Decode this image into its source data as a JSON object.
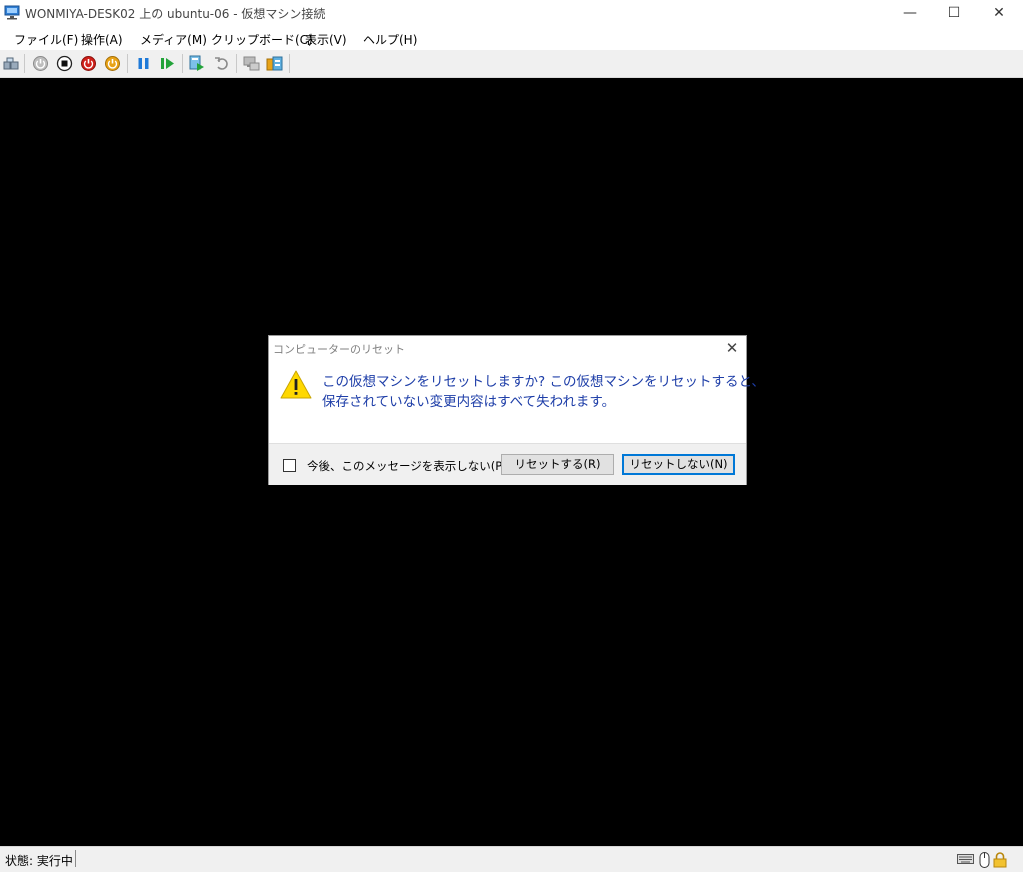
{
  "window": {
    "title": "WONMIYA-DESK02 上の ubuntu-06  - 仮想マシン接続",
    "minimize": "—",
    "maximize": "☐",
    "close": "✕"
  },
  "menu": {
    "items": [
      "ファイル(F)",
      "操作(A)",
      "メディア(M)",
      "クリップボード(C)",
      "表示(V)",
      "ヘルプ(H)"
    ]
  },
  "toolbar": {
    "icons": [
      "ctrl-alt-del-icon",
      "start-icon",
      "turn-off-icon",
      "shutdown-icon",
      "save-icon",
      "pause-icon",
      "resume-icon",
      "checkpoint-icon",
      "revert-icon",
      "enhanced-session-icon",
      "share-icon"
    ]
  },
  "dialog": {
    "title": "コンピューターのリセット",
    "message_line1": "この仮想マシンをリセットしますか? この仮想マシンをリセットすると、",
    "message_line2": "保存されていない変更内容はすべて失われます。",
    "checkbox_label": "今後、このメッセージを表示しない(P)",
    "checkbox_checked": false,
    "reset_button": "リセットする(R)",
    "cancel_button": "リセットしない(N)",
    "close": "✕"
  },
  "status": {
    "text": "状態: 実行中"
  },
  "colors": {
    "message": "#1e3ea8",
    "default_button_border": "#0078d7",
    "warning_yellow": "#ffd800"
  }
}
